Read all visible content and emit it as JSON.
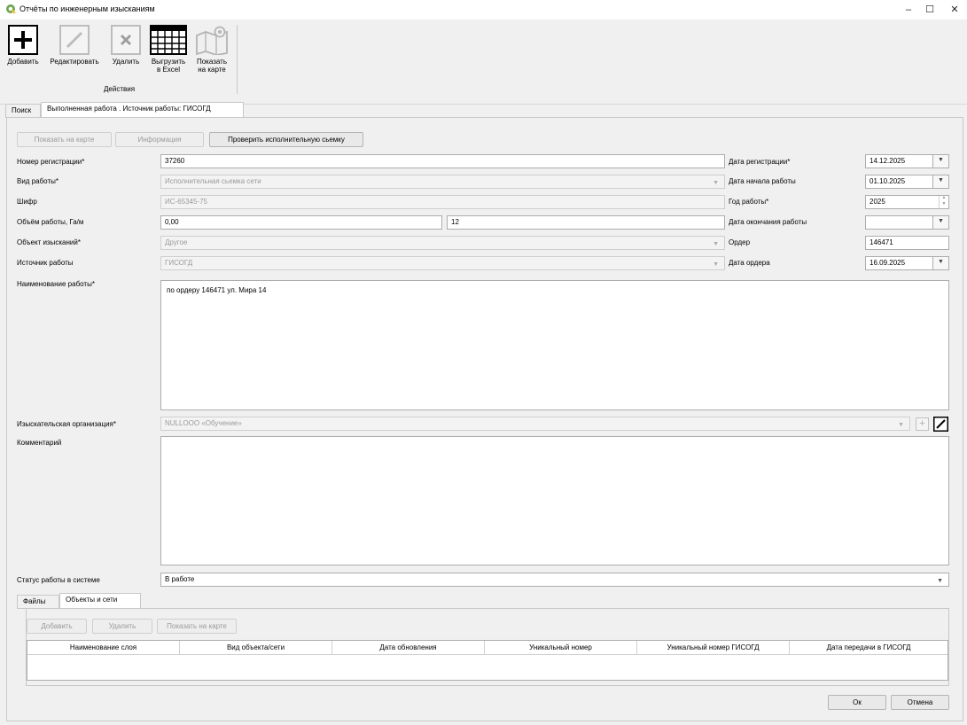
{
  "window": {
    "title": "Отчёты по инженерным изысканиям",
    "controls": [
      "–",
      "☐",
      "✕"
    ]
  },
  "toolbar": {
    "add": "Добавить",
    "edit": "Редактировать",
    "delete": "Удалить",
    "export_line1": "Выгрузить",
    "export_line2": "в Excel",
    "map_line1": "Показать",
    "map_line2": "на карте",
    "group": "Действия"
  },
  "tabs": {
    "search": "Поиск",
    "work": "Выполненная работа . Источник работы: ГИСОГД"
  },
  "actions": {
    "show_on_map": "Показать на карте",
    "info": "Информация",
    "check_survey": "Проверить исполнительную сьемку"
  },
  "form": {
    "reg_number_label": "Номер регистрации*",
    "reg_number": "37260",
    "work_type_label": "Вид работы*",
    "work_type": "Исполнительная сьемка сети",
    "code_label": "Шифр",
    "code": "ИС-65345-75",
    "volume_label": "Объём работы, Га/м",
    "volume_ga": "0,00",
    "volume_m": "12",
    "object_label": "Объект изысканий*",
    "object": "Другое",
    "source_label": "Источник работы",
    "source": "ГИСОГД",
    "name_label": "Наименование работы*",
    "name": "по ордеру 146471 ул. Мира 14",
    "org_label": "Изыскательская организация*",
    "org": "NULLООО «Обучение»",
    "comment_label": "Комментарий",
    "comment": "",
    "status_label": "Статус работы в системе",
    "status": "В работе"
  },
  "right_form": {
    "reg_date_label": "Дата регистрации*",
    "reg_date": "14.12.2025",
    "start_date_label": "Дата начала работы",
    "start_date": "01.10.2025",
    "year_label": "Год работы*",
    "year": "2025",
    "end_date_label": "Дата окончания работы",
    "end_date": "",
    "order_label": "Ордер",
    "order": "146471",
    "order_date_label": "Дата ордера",
    "order_date": "16.09.2025"
  },
  "bottom_tabs": {
    "files": "Файлы",
    "objects": "Объекты и сети"
  },
  "bottom_actions": {
    "add": "Добавить",
    "delete": "Удалить",
    "show_on_map": "Показать на карте"
  },
  "table": {
    "columns": [
      "Наименование слоя",
      "Вид объекта/сети",
      "Дата обновления",
      "Уникальный номер",
      "Уникальный номер ГИСОГД",
      "Дата передачи в ГИСОГД"
    ]
  },
  "dialog": {
    "ok": "Ок",
    "cancel": "Отмена"
  },
  "colors": {
    "app_icon": "#6aa84f",
    "background": "#f0f0f0"
  }
}
